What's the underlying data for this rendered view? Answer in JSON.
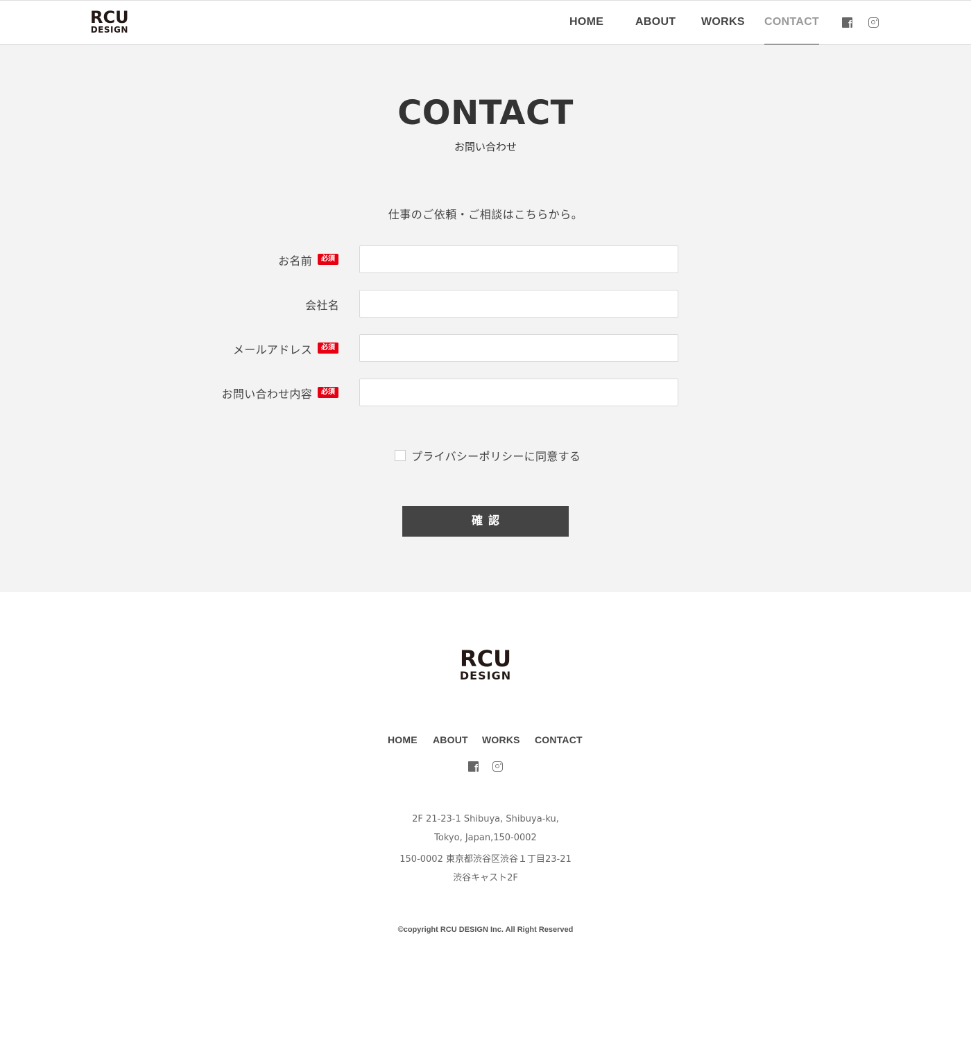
{
  "header": {
    "logo": {
      "line1": "RCU",
      "line2": "DESIGN"
    },
    "nav": [
      {
        "label": "HOME"
      },
      {
        "label": "ABOUT"
      },
      {
        "label": "WORKS"
      },
      {
        "label": "CONTACT",
        "active": true
      }
    ],
    "social": {
      "facebook_icon": "facebook-icon",
      "instagram_icon": "instagram-icon",
      "facebook_glyph": "f"
    }
  },
  "main": {
    "title": "CONTACT",
    "subtitle": "お問い合わせ",
    "intro": "仕事のご依頼・ご相談はこちらから。",
    "required_badge": "必須",
    "fields": [
      {
        "label": "お名前",
        "required": true,
        "value": ""
      },
      {
        "label": "会社名",
        "required": false,
        "value": ""
      },
      {
        "label": "メールアドレス",
        "required": true,
        "value": ""
      },
      {
        "label": "お問い合わせ内容",
        "required": true,
        "value": ""
      }
    ],
    "privacy_label": "プライバシーポリシーに同意する",
    "privacy_checked": false,
    "submit_label": "確認"
  },
  "footer": {
    "logo": {
      "line1": "RCU",
      "line2": "DESIGN"
    },
    "nav": [
      {
        "label": "HOME"
      },
      {
        "label": "ABOUT"
      },
      {
        "label": "WORKS"
      },
      {
        "label": "CONTACT"
      }
    ],
    "address": [
      "2F 21-23-1 Shibuya, Shibuya-ku,",
      "Tokyo, Japan,150-0002",
      "150-0002 東京都渋谷区渋谷１丁目23-21",
      "渋谷キャスト2F"
    ],
    "copyright": "©copyright RCU DESIGN Inc. All Right Reserved"
  },
  "colors": {
    "background_main": "#f3f3f3",
    "text_primary": "#333333",
    "required_badge": "#e60012",
    "submit_button": "#444444",
    "nav_active": "#999999"
  }
}
